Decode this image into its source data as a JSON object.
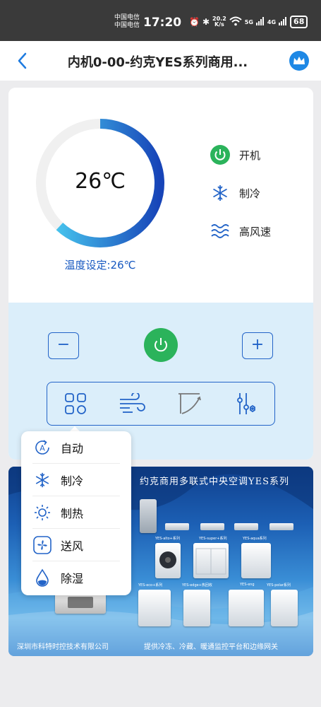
{
  "status_bar": {
    "carrier_1": "中国电信",
    "carrier_2": "中国电信",
    "time": "17:20",
    "speed_value": "20.2",
    "speed_unit": "K/s",
    "net_1": "5G",
    "net_2": "4G",
    "battery": "68"
  },
  "header": {
    "title": "内机0-00-约克YES系列商用..."
  },
  "thermostat": {
    "current_temp": "26℃",
    "setpoint_label": "温度设定:26℃",
    "ring_fill_fraction": 0.62
  },
  "status_list": [
    {
      "label": "开机",
      "icon": "power-icon"
    },
    {
      "label": "制冷",
      "icon": "snowflake-icon"
    },
    {
      "label": "高风速",
      "icon": "wind-waves-icon"
    }
  ],
  "controls": {
    "minus": "−",
    "plus": "+"
  },
  "toolbar": [
    {
      "name": "mode-grid-icon"
    },
    {
      "name": "fan-speed-icon"
    },
    {
      "name": "swing-flap-icon"
    },
    {
      "name": "settings-sliders-icon"
    }
  ],
  "mode_menu": [
    {
      "label": "自动",
      "icon": "auto-icon"
    },
    {
      "label": "制冷",
      "icon": "snowflake-icon"
    },
    {
      "label": "制热",
      "icon": "sun-icon"
    },
    {
      "label": "送风",
      "icon": "fan-icon"
    },
    {
      "label": "除湿",
      "icon": "droplet-icon"
    }
  ],
  "banner": {
    "title": "约克商用多联式中央空调YES系列",
    "footer_left": "深圳市科特时控技术有限公司",
    "footer_right": "提供冷冻、冷藏、暖通监控平台和边缘网关",
    "labels": [
      "YES-alto+系列",
      "YES-super+系列",
      "YES-aqua系列",
      "YES-eco+系列",
      "YES-edge+热回收",
      "YES-eng",
      "YES-polar系列"
    ]
  },
  "colors": {
    "accent_blue": "#2364c8",
    "power_green": "#2bb35b",
    "ring_light": "#4dd6f5",
    "ring_dark": "#1744b8"
  }
}
